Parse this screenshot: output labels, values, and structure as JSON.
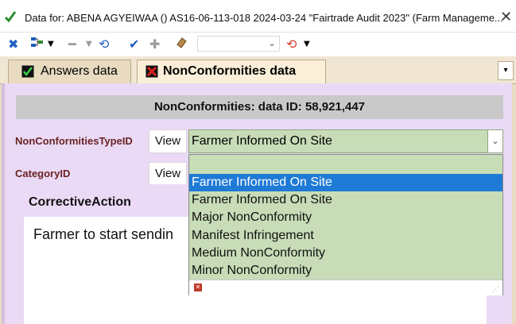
{
  "window": {
    "title": "Data for: ABENA AGYEIWAA  () AS16-06-113-018 2024-03-24 \"Fairtrade Audit 2023\"  (Farm Manageme...",
    "close": "✕"
  },
  "toolbar": {
    "icons": [
      "close-x-icon",
      "org-chart-icon",
      "minus-icon",
      "refresh-icon",
      "checkmark-icon",
      "plus-icon",
      "eraser-icon",
      "undo-icon"
    ],
    "accent_color": "#1f5fbf",
    "combo_value": ""
  },
  "tabs": [
    {
      "label": "Answers data",
      "active": false
    },
    {
      "label": "NonConformities data",
      "active": true
    }
  ],
  "form": {
    "header": "NonConformities: data ID: 58,921,447",
    "fields": [
      {
        "label": "NonConformitiesTypeID",
        "view_label": "View",
        "value": "Farmer Informed On Site"
      },
      {
        "label": "CategoryID",
        "view_label": "View",
        "value": ""
      }
    ],
    "corrective_action": {
      "label": "CorrectiveAction",
      "text": "Farmer to start sendin"
    }
  },
  "dropdown": {
    "options": [
      "",
      "Farmer Informed On Site",
      "Farmer Informed On Site",
      "Major NonConformity",
      "Manifest Infringement",
      "Medium NonConformity",
      "Minor NonConformity"
    ],
    "selected_index": 1
  },
  "colors": {
    "selected": "#1f7ad6",
    "field_bg": "#c7dcb7",
    "label": "#6a2323",
    "panel": "#eadaf5"
  }
}
